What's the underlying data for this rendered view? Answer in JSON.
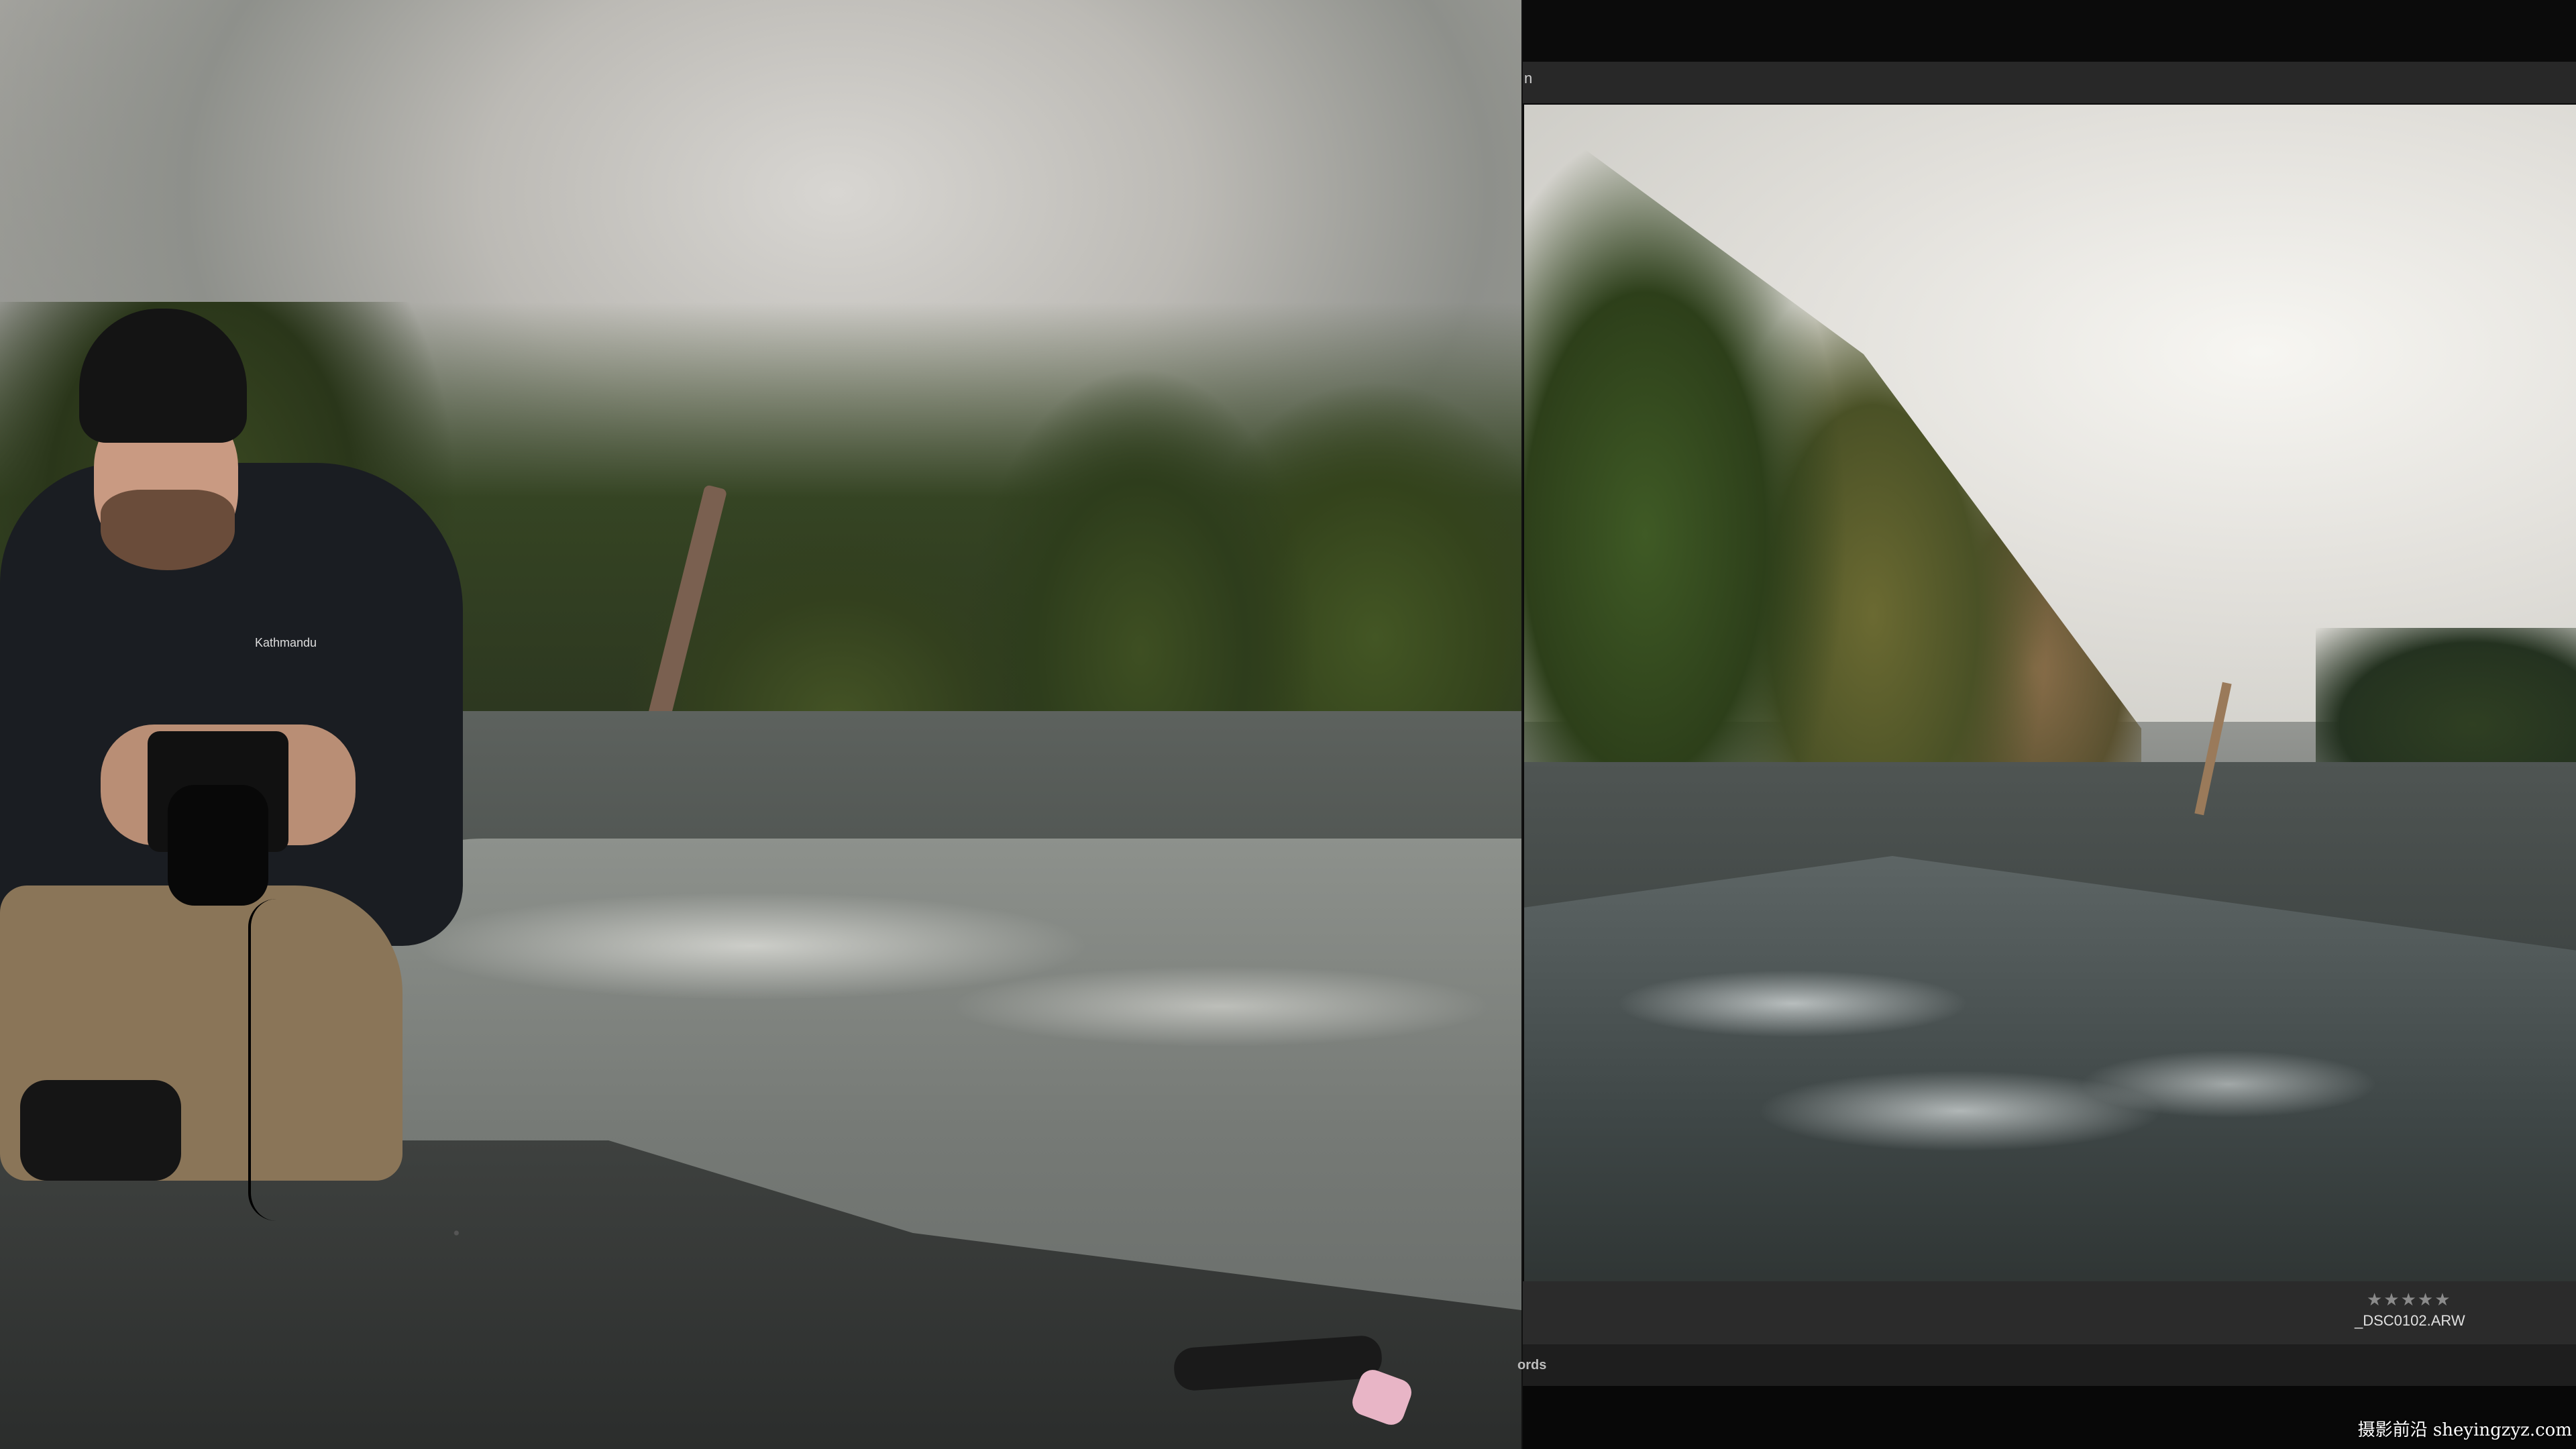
{
  "left_panel": {
    "jacket_brand": "Kathmandu"
  },
  "editor": {
    "toolbar_glyph": "n",
    "photo": {
      "rating": "★★★★★",
      "filename": "_DSC0102.ARW"
    },
    "keywords_label": "ords"
  },
  "watermark": "摄影前沿 sheyingzyz.com"
}
